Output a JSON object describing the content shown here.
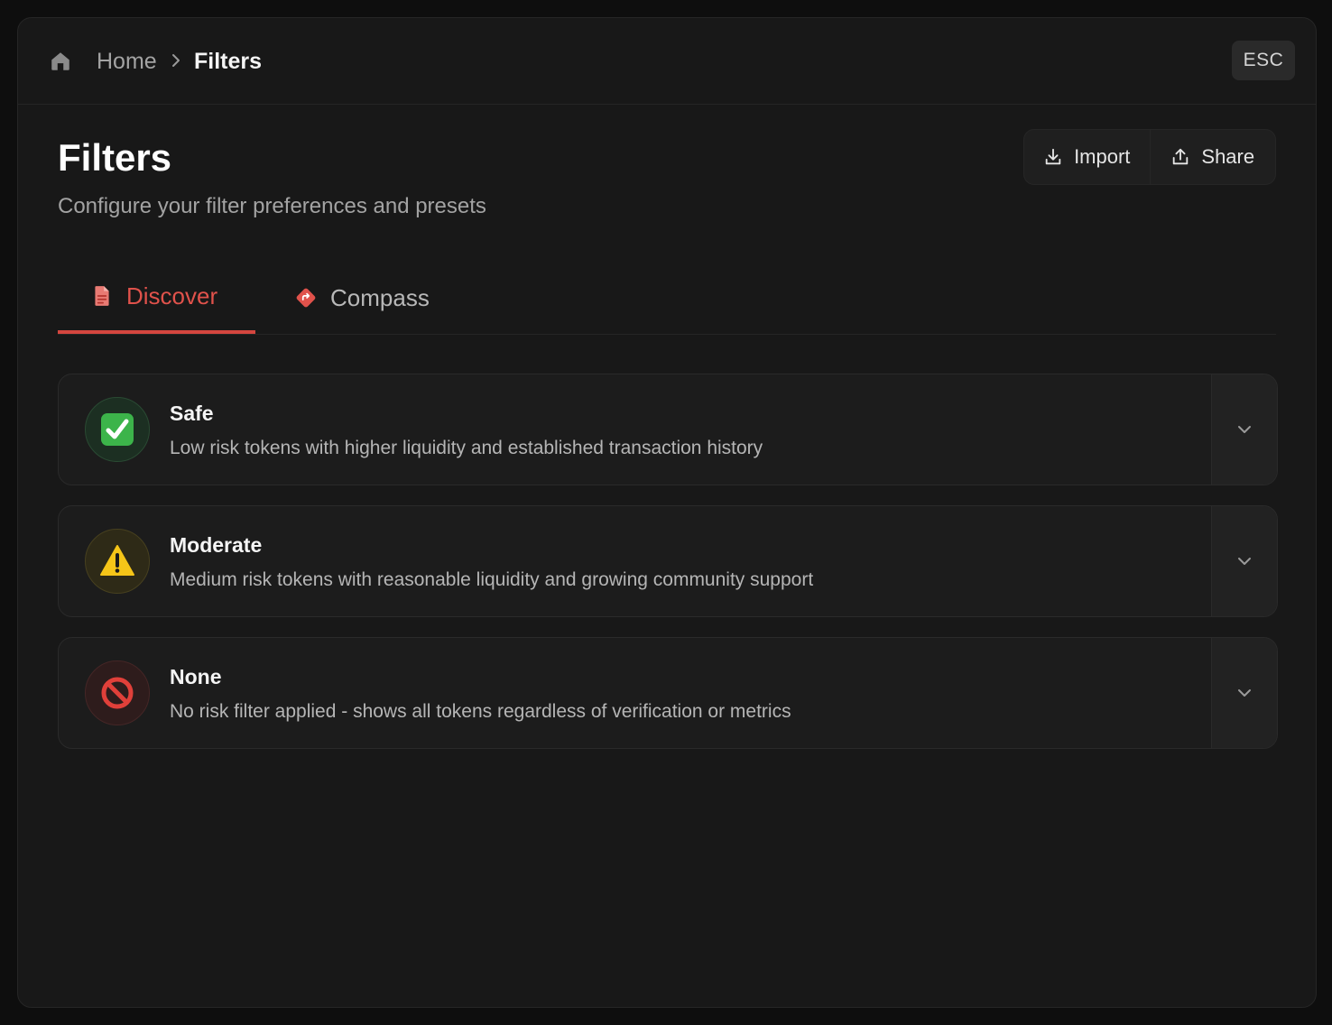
{
  "breadcrumb": {
    "home_label": "Home",
    "current_label": "Filters"
  },
  "esc_label": "ESC",
  "header": {
    "title": "Filters",
    "subtitle": "Configure your filter preferences and presets"
  },
  "actions": {
    "import_label": "Import",
    "share_label": "Share"
  },
  "tabs": [
    {
      "label": "Discover",
      "icon": "document-icon",
      "active": true
    },
    {
      "label": "Compass",
      "icon": "compass-icon",
      "active": false
    }
  ],
  "presets": [
    {
      "title": "Safe",
      "description": "Low risk tokens with higher liquidity and established transaction history",
      "icon": "check-mark-icon",
      "color": "#22c55e"
    },
    {
      "title": "Moderate",
      "description": "Medium risk tokens with reasonable liquidity and growing community support",
      "icon": "warning-icon",
      "color": "#eab308"
    },
    {
      "title": "None",
      "description": "No risk filter applied - shows all tokens regardless of verification or metrics",
      "icon": "prohibited-icon",
      "color": "#ef4444"
    }
  ],
  "colors": {
    "accent": "#e0524b",
    "background": "#181818"
  }
}
